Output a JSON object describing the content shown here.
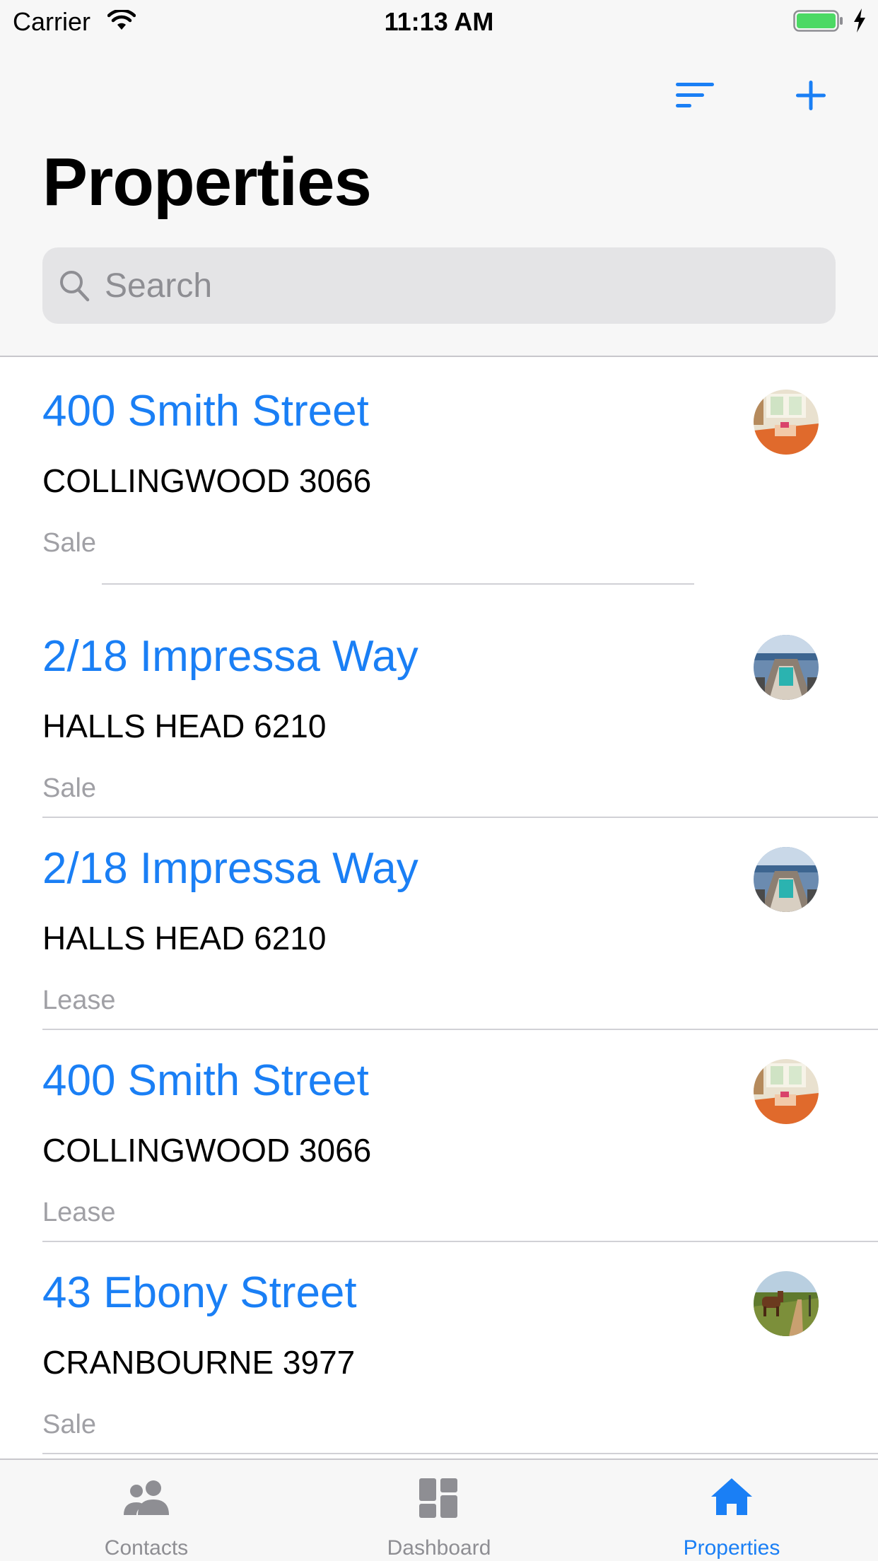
{
  "status_bar": {
    "carrier": "Carrier",
    "time": "11:13 AM"
  },
  "nav": {
    "title": "Properties",
    "search_placeholder": "Search",
    "icons": [
      "sort-icon",
      "plus-icon"
    ]
  },
  "properties": [
    {
      "address": "400 Smith Street",
      "suburb": "COLLINGWOOD 3066",
      "type": "Sale",
      "thumbnail": "interior-photo"
    },
    {
      "address": "2/18 Impressa Way",
      "suburb": "HALLS HEAD 6210",
      "type": "Sale",
      "thumbnail": "pool-deck-photo"
    },
    {
      "address": "2/18 Impressa Way",
      "suburb": "HALLS HEAD 6210",
      "type": "Lease",
      "thumbnail": "pool-deck-photo"
    },
    {
      "address": "400 Smith Street",
      "suburb": "COLLINGWOOD 3066",
      "type": "Lease",
      "thumbnail": "interior-photo"
    },
    {
      "address": "43 Ebony Street",
      "suburb": "CRANBOURNE 3977",
      "type": "Sale",
      "thumbnail": "horse-field-photo"
    }
  ],
  "tab_bar": {
    "tabs": [
      {
        "label": "Contacts",
        "icon": "people-icon",
        "active": false
      },
      {
        "label": "Dashboard",
        "icon": "dashboard-icon",
        "active": false
      },
      {
        "label": "Properties",
        "icon": "house-icon",
        "active": true
      }
    ]
  },
  "colors": {
    "accent": "#1a7ff5",
    "secondary_text": "#a0a0a5",
    "battery": "#4cd964"
  }
}
